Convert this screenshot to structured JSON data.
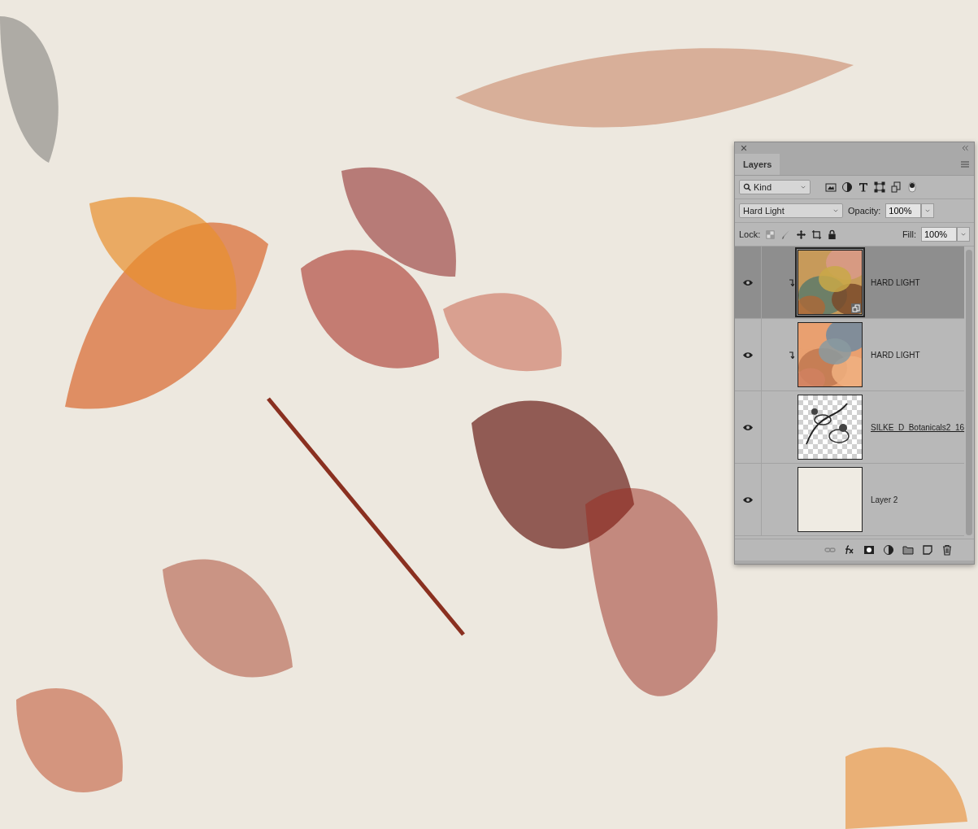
{
  "panel": {
    "tab": "Layers",
    "filter": {
      "value": "Kind"
    },
    "blend_mode": {
      "value": "Hard Light"
    },
    "opacity": {
      "label": "Opacity:",
      "value": "100%"
    },
    "lock": {
      "label": "Lock:"
    },
    "fill": {
      "label": "Fill:",
      "value": "100%"
    },
    "layers": [
      {
        "name": "HARD LIGHT",
        "kind": "texture",
        "selected": true,
        "visible": true,
        "clipped": true,
        "smart_object": true,
        "underlined": false
      },
      {
        "name": "HARD LIGHT",
        "kind": "texture",
        "selected": false,
        "visible": true,
        "clipped": true,
        "smart_object": false,
        "underlined": false
      },
      {
        "name": "SILKE_D_Botanicals2_16",
        "kind": "transparent",
        "selected": false,
        "visible": true,
        "clipped": false,
        "smart_object": false,
        "underlined": true
      },
      {
        "name": "Layer 2",
        "kind": "solid",
        "selected": false,
        "visible": true,
        "clipped": false,
        "smart_object": false,
        "underlined": false
      }
    ]
  }
}
